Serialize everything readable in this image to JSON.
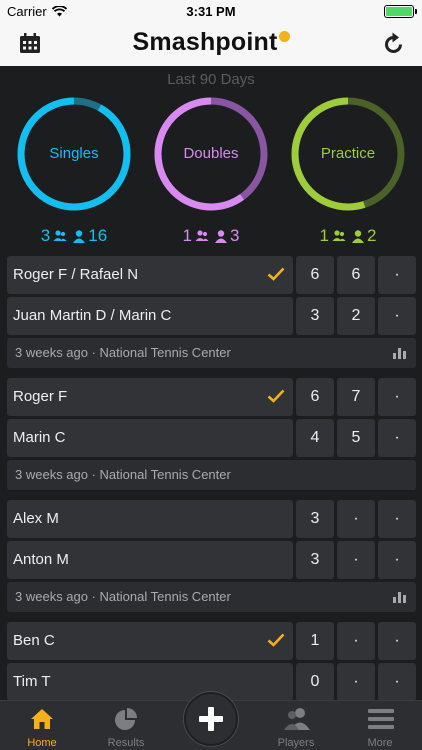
{
  "status": {
    "carrier": "Carrier",
    "time": "3:31 PM"
  },
  "nav": {
    "title": "Smashpoint"
  },
  "summary": {
    "period": "Last 90 Days",
    "rings": [
      {
        "label": "Singles",
        "color": "#12bff0",
        "track": "#1f6f88",
        "fraction": 0.92,
        "teams": "3",
        "players": "16"
      },
      {
        "label": "Doubles",
        "color": "#d98af0",
        "track": "#8a55a3",
        "fraction": 0.6,
        "teams": "1",
        "players": "3"
      },
      {
        "label": "Practice",
        "color": "#9fcc3b",
        "track": "#4a6128",
        "fraction": 0.55,
        "teams": "1",
        "players": "2"
      }
    ]
  },
  "matches": [
    {
      "top": {
        "name": "Roger F / Rafael N",
        "winner": true,
        "scores": [
          "6",
          "6",
          "·"
        ]
      },
      "bottom": {
        "name": "Juan Martin D / Marin C",
        "winner": false,
        "scores": [
          "3",
          "2",
          "·"
        ]
      },
      "info": "3 weeks ago · National Tennis Center",
      "stats": true
    },
    {
      "top": {
        "name": "Roger F",
        "winner": true,
        "scores": [
          "6",
          "7",
          "·"
        ]
      },
      "bottom": {
        "name": "Marin C",
        "winner": false,
        "scores": [
          "4",
          "5",
          "·"
        ]
      },
      "info": "3 weeks ago · National Tennis Center",
      "stats": false
    },
    {
      "top": {
        "name": "Alex M",
        "winner": false,
        "scores": [
          "3",
          "·",
          "·"
        ]
      },
      "bottom": {
        "name": "Anton M",
        "winner": false,
        "scores": [
          "3",
          "·",
          "·"
        ]
      },
      "info": "3 weeks ago · National Tennis Center",
      "stats": true
    },
    {
      "top": {
        "name": "Ben C",
        "winner": true,
        "scores": [
          "1",
          "·",
          "·"
        ]
      },
      "bottom": {
        "name": "Tim T",
        "winner": false,
        "scores": [
          "0",
          "·",
          "·"
        ]
      },
      "info": "",
      "stats": false
    }
  ],
  "tabs": [
    {
      "label": "Home",
      "icon": "home-icon",
      "active": true
    },
    {
      "label": "Results",
      "icon": "pie-chart-icon",
      "active": false
    },
    {
      "label": "Players",
      "icon": "players-icon",
      "active": false
    },
    {
      "label": "More",
      "icon": "menu-icon",
      "active": false
    }
  ],
  "colors": {
    "accent": "#f3b21c",
    "cell": "#323337",
    "background": "#1c1d1f"
  }
}
